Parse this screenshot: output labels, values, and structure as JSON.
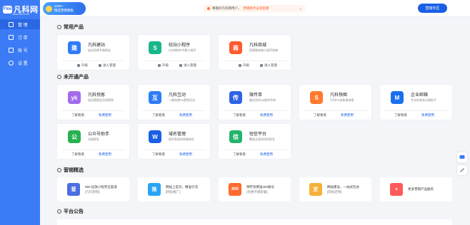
{
  "sidebar": {
    "logo_mark": "Fkw",
    "logo_text": "凡科网",
    "logo_url": "www.fkw.com",
    "items": [
      {
        "label": "管 理"
      },
      {
        "label": "订 单"
      },
      {
        "label": "账 号"
      },
      {
        "label": "设 置"
      }
    ]
  },
  "topbar": {
    "promo_line1": "2000+",
    "promo_line2": "精选营销模板",
    "notice_text": "尊敬的凡科网用户，",
    "notice_highlight": "营销新手必读指南",
    "notice_close": "×",
    "help_label": "营销专区"
  },
  "sections": {
    "common": "常用产品",
    "unopened": "未开通产品",
    "marketing": "营销精选",
    "announcement": "平台公告"
  },
  "common_products": [
    {
      "title": "凡科建站",
      "desc": "轻松搭建专属网站",
      "a1": "升级",
      "a2": "进入管理",
      "icon": "建",
      "color": "#2f7cf6"
    },
    {
      "title": "轻站小程序",
      "desc": "5分钟制作专属小程序",
      "a1": "升级",
      "a2": "进入管理",
      "icon": "S",
      "color": "#19b58b"
    },
    {
      "title": "凡科商城",
      "desc": "搭建微商城小程序商城",
      "a1": "升级",
      "a2": "进入管理",
      "icon": "商",
      "color": "#ff5a2e"
    }
  ],
  "unopened_products": [
    {
      "title": "凡科悦客",
      "desc": "轻松管理会员和营销",
      "a1": "了解看看",
      "a2": "免费使用",
      "icon": "yk",
      "color": "#a26bea"
    },
    {
      "title": "凡科互动",
      "desc": "一键创建H5营销活动",
      "a1": "了解看看",
      "a2": "免费使用",
      "icon": "互",
      "color": "#2f7cf6"
    },
    {
      "title": "微传单",
      "desc": "最实用的H5制作传单",
      "a1": "了解看看",
      "a2": "免费使用",
      "icon": "传",
      "color": "#2f62e6"
    },
    {
      "title": "凡科快图",
      "desc": "不用PS也能做海报",
      "a1": "了解看看",
      "a2": "免费使用",
      "icon": "S",
      "color": "#ff7a2e"
    },
    {
      "title": "企业邮箱",
      "desc": "专业的商务沟通助手",
      "a1": "了解看看",
      "a2": "免费使用",
      "icon": "M",
      "color": "#1a6ff0"
    },
    {
      "title": "公众号助手",
      "desc": "无限群发",
      "a1": "了解看看",
      "a2": "免费使用",
      "icon": "公",
      "color": "#27b24f"
    },
    {
      "title": "域名管理",
      "desc": "提供高速的网络域名",
      "a1": "了解看看",
      "a2": "免费使用",
      "icon": "W",
      "color": "#1a5fe6"
    },
    {
      "title": "短信平台",
      "desc": "覆盖全面的短信群发",
      "a1": "了解看看",
      "a2": "免费使用",
      "icon": "信",
      "color": "#23b46b"
    }
  ],
  "marketing": [
    {
      "line1": "¥50 投放小程序全渠道",
      "line2": "[凡科营销]",
      "icon": "营",
      "color": "#4b6fe0"
    },
    {
      "line1": "网站上首页，精准引流",
      "line2": "[网站推广]",
      "icon": "推",
      "color": "#2aa4f4"
    },
    {
      "line1": "预存资费送400账号",
      "line2": "[优惠存储套餐]",
      "icon": "400",
      "color": "#ff6a2e"
    },
    {
      "line1": "网站建设，一站式包办",
      "line2": "[网站定制]",
      "icon": "定",
      "color": "#f5b13a"
    },
    {
      "line1": "更多营销产品服务",
      "line2": "",
      "icon": "+",
      "color": "#ff5a5a"
    }
  ],
  "float_buttons": [
    "chat-icon",
    "edit-icon"
  ]
}
